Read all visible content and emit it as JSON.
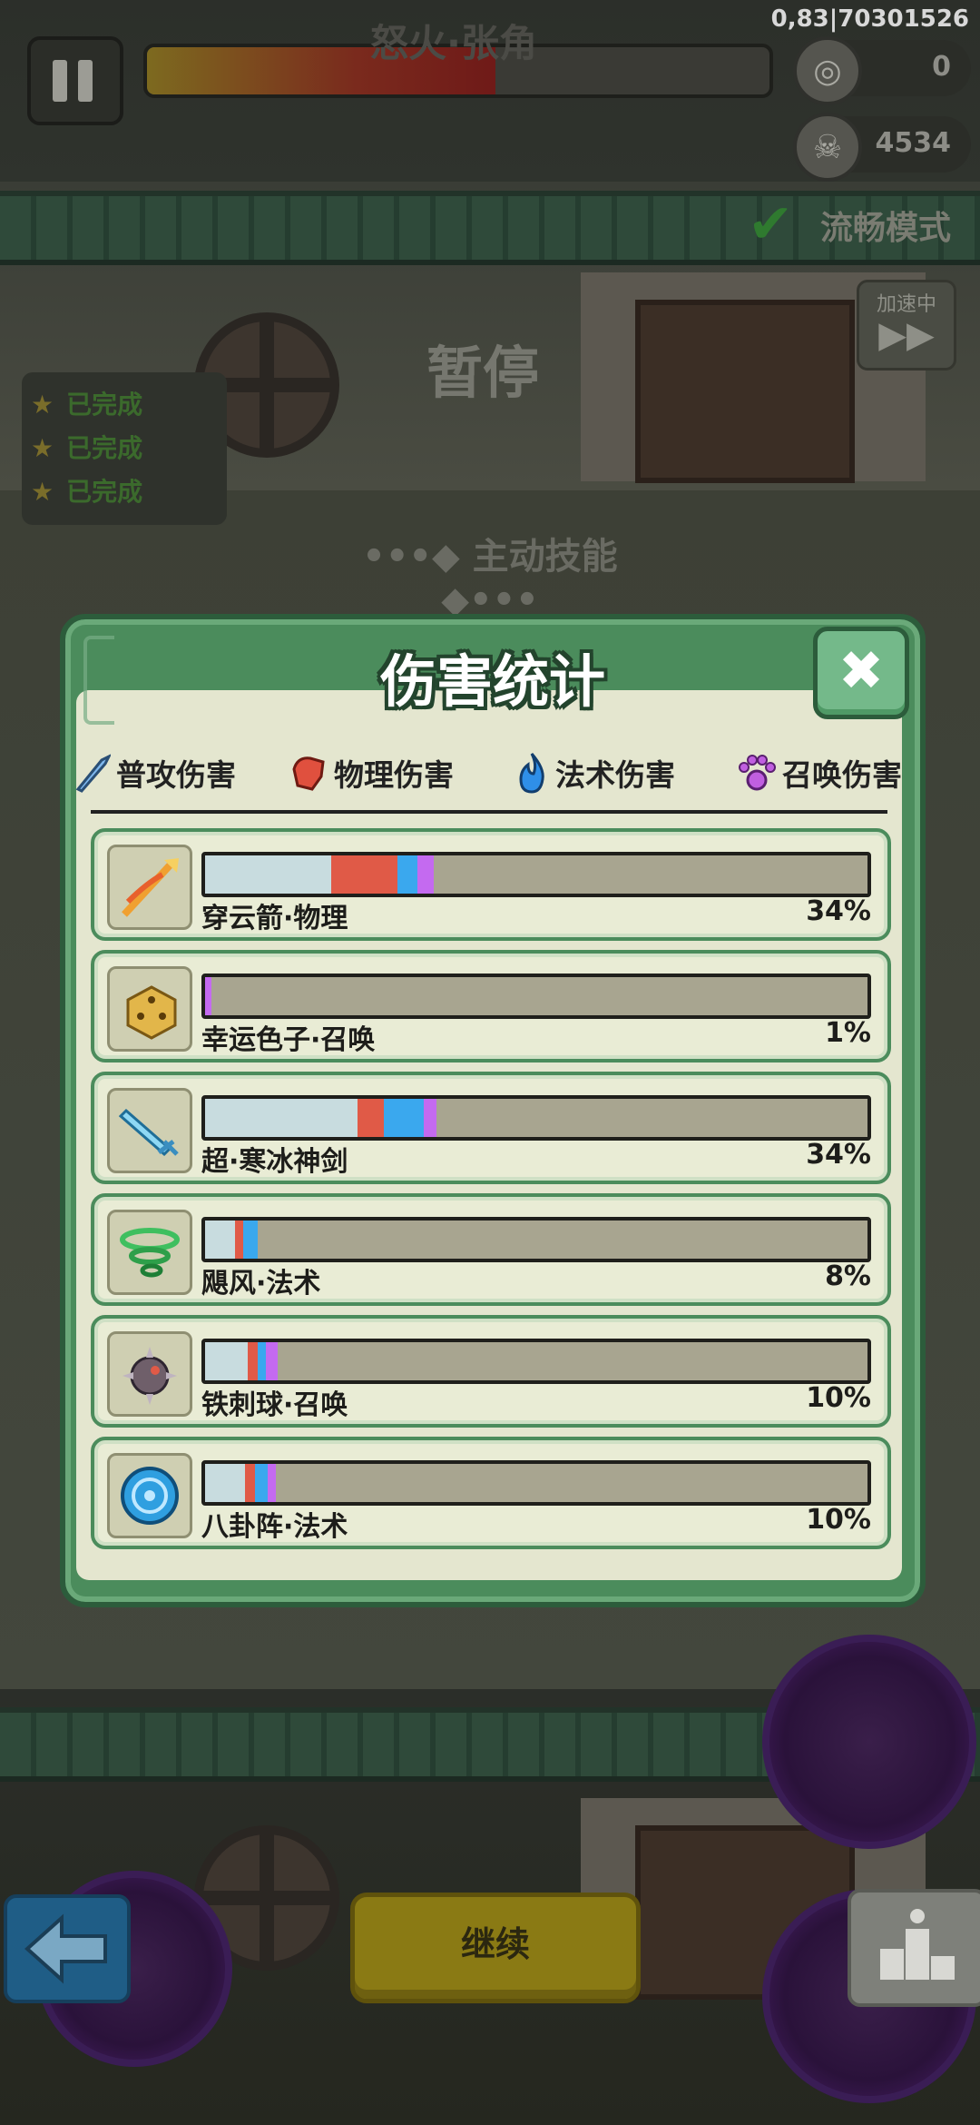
{
  "hud": {
    "version": "0,83|70301526",
    "boss_name": "怒火·张角",
    "boss_hp_fraction": 0.56,
    "coins": "0",
    "kills": "4534",
    "smooth_mode": "流畅模式",
    "speed_label": "加速中",
    "paused_label": "暂停",
    "quests": [
      "已完成",
      "已完成",
      "已完成"
    ],
    "skills_header": "•••◆ 主动技能 ◆•••"
  },
  "modal": {
    "title": "伤害统计",
    "legend": [
      {
        "label": "普攻伤害",
        "color": "#7fb8ee",
        "icon": "sword-icon"
      },
      {
        "label": "物理伤害",
        "color": "#e0503e",
        "icon": "fist-icon"
      },
      {
        "label": "法术伤害",
        "color": "#2f8fe8",
        "icon": "flame-icon"
      },
      {
        "label": "召唤伤害",
        "color": "#c05fe0",
        "icon": "paw-icon"
      }
    ],
    "rows": [
      {
        "name": "穿云箭·物理",
        "pct": "34%",
        "icon": "arrow-burst-icon",
        "segments": [
          {
            "color": "#c8dcdf",
            "value": 0.19
          },
          {
            "color": "#e05a47",
            "value": 0.1
          },
          {
            "color": "#3aa8ee",
            "value": 0.03
          },
          {
            "color": "#c46af0",
            "value": 0.025
          }
        ]
      },
      {
        "name": "幸运色子·召唤",
        "pct": "1%",
        "icon": "dice-icon",
        "segments": [
          {
            "color": "#c46af0",
            "value": 0.01
          }
        ]
      },
      {
        "name": "超·寒冰神剑",
        "pct": "34%",
        "icon": "ice-sword-icon",
        "segments": [
          {
            "color": "#c8dcdf",
            "value": 0.23
          },
          {
            "color": "#e05a47",
            "value": 0.04
          },
          {
            "color": "#3aa8ee",
            "value": 0.06
          },
          {
            "color": "#c46af0",
            "value": 0.02
          }
        ]
      },
      {
        "name": "飓风·法术",
        "pct": "8%",
        "icon": "tornado-icon",
        "segments": [
          {
            "color": "#c8dcdf",
            "value": 0.045
          },
          {
            "color": "#e05a47",
            "value": 0.012
          },
          {
            "color": "#3aa8ee",
            "value": 0.022
          }
        ]
      },
      {
        "name": "铁刺球·召唤",
        "pct": "10%",
        "icon": "spike-ball-icon",
        "segments": [
          {
            "color": "#c8dcdf",
            "value": 0.065
          },
          {
            "color": "#e05a47",
            "value": 0.015
          },
          {
            "color": "#3aa8ee",
            "value": 0.012
          },
          {
            "color": "#c46af0",
            "value": 0.018
          }
        ]
      },
      {
        "name": "八卦阵·法术",
        "pct": "10%",
        "icon": "bagua-icon",
        "segments": [
          {
            "color": "#c8dcdf",
            "value": 0.06
          },
          {
            "color": "#e05a47",
            "value": 0.015
          },
          {
            "color": "#3aa8ee",
            "value": 0.02
          },
          {
            "color": "#c46af0",
            "value": 0.012
          }
        ]
      }
    ]
  },
  "bottom": {
    "continue_label": "继续"
  }
}
